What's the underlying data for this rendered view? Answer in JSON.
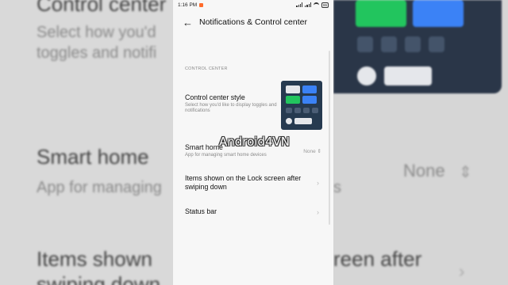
{
  "status_bar": {
    "time": "1:16 PM",
    "battery": "86"
  },
  "header": {
    "title": "Notifications & Control center"
  },
  "section": {
    "label": "CONTROL CENTER"
  },
  "rows": [
    {
      "title": "Control center style",
      "subtitle": "Select how you'd like to display toggles and notifications"
    },
    {
      "title": "Smart home",
      "subtitle": "App for managing smart home devices",
      "value": "None"
    },
    {
      "title": "Items shown on the Lock screen after swiping down"
    },
    {
      "title": "Status bar"
    }
  ],
  "watermark": "Android4VN",
  "background": {
    "left_lines": [
      "Control center",
      "Select how you'd",
      "toggles and notifi",
      "Smart home",
      "App for managing",
      "Items shown",
      "swiping down"
    ],
    "right_lines": [
      "None",
      "s",
      "reen after"
    ]
  },
  "colors": {
    "thumb_bg": "#263a50",
    "tile_blue": "#3b82f6",
    "tile_green": "#22c55e",
    "tile_white": "#e5e7eb"
  }
}
